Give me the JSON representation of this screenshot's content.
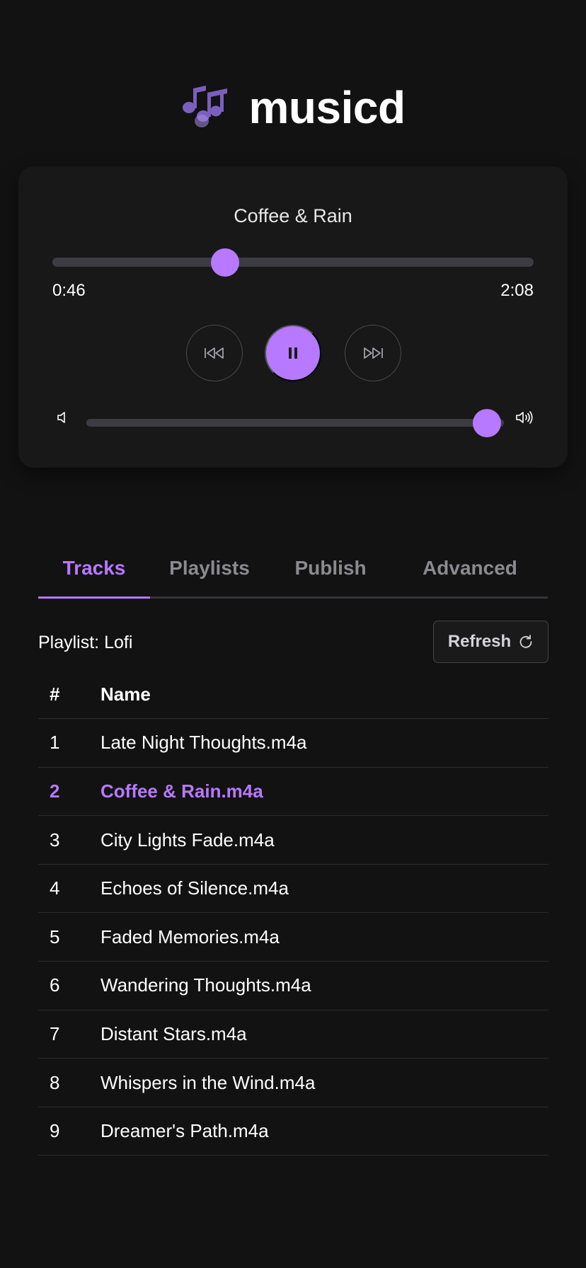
{
  "app": {
    "title": "musicd",
    "logo_icon": "music-notes-icon"
  },
  "player": {
    "now_playing": "Coffee & Rain",
    "current_time": "0:46",
    "total_time": "2:08",
    "progress": 0.359,
    "volume": 0.96,
    "is_playing": true,
    "controls": {
      "prev_icon": "skip-back-icon",
      "play_icon": "pause-icon",
      "next_icon": "skip-forward-icon"
    },
    "volume_down_icon": "speaker-low-icon",
    "volume_up_icon": "speaker-high-icon"
  },
  "tabs": [
    {
      "label": "Tracks",
      "active": true
    },
    {
      "label": "Playlists",
      "active": false
    },
    {
      "label": "Publish",
      "active": false
    },
    {
      "label": "Advanced",
      "active": false
    }
  ],
  "toolbar": {
    "playlist_label": "Playlist: Lofi",
    "refresh_label": "Refresh",
    "refresh_icon": "refresh-icon"
  },
  "table": {
    "columns": [
      "#",
      "Name"
    ],
    "rows": [
      {
        "num": "1",
        "name": "Late Night Thoughts.m4a",
        "active": false
      },
      {
        "num": "2",
        "name": "Coffee & Rain.m4a",
        "active": true
      },
      {
        "num": "3",
        "name": "City Lights Fade.m4a",
        "active": false
      },
      {
        "num": "4",
        "name": "Echoes of Silence.m4a",
        "active": false
      },
      {
        "num": "5",
        "name": "Faded Memories.m4a",
        "active": false
      },
      {
        "num": "6",
        "name": "Wandering Thoughts.m4a",
        "active": false
      },
      {
        "num": "7",
        "name": "Distant Stars.m4a",
        "active": false
      },
      {
        "num": "8",
        "name": "Whispers in the Wind.m4a",
        "active": false
      },
      {
        "num": "9",
        "name": "Dreamer's Path.m4a",
        "active": false
      }
    ]
  },
  "colors": {
    "accent": "#b779ff",
    "background": "#121212",
    "card": "#181818",
    "logo": "#7b5fbf"
  }
}
